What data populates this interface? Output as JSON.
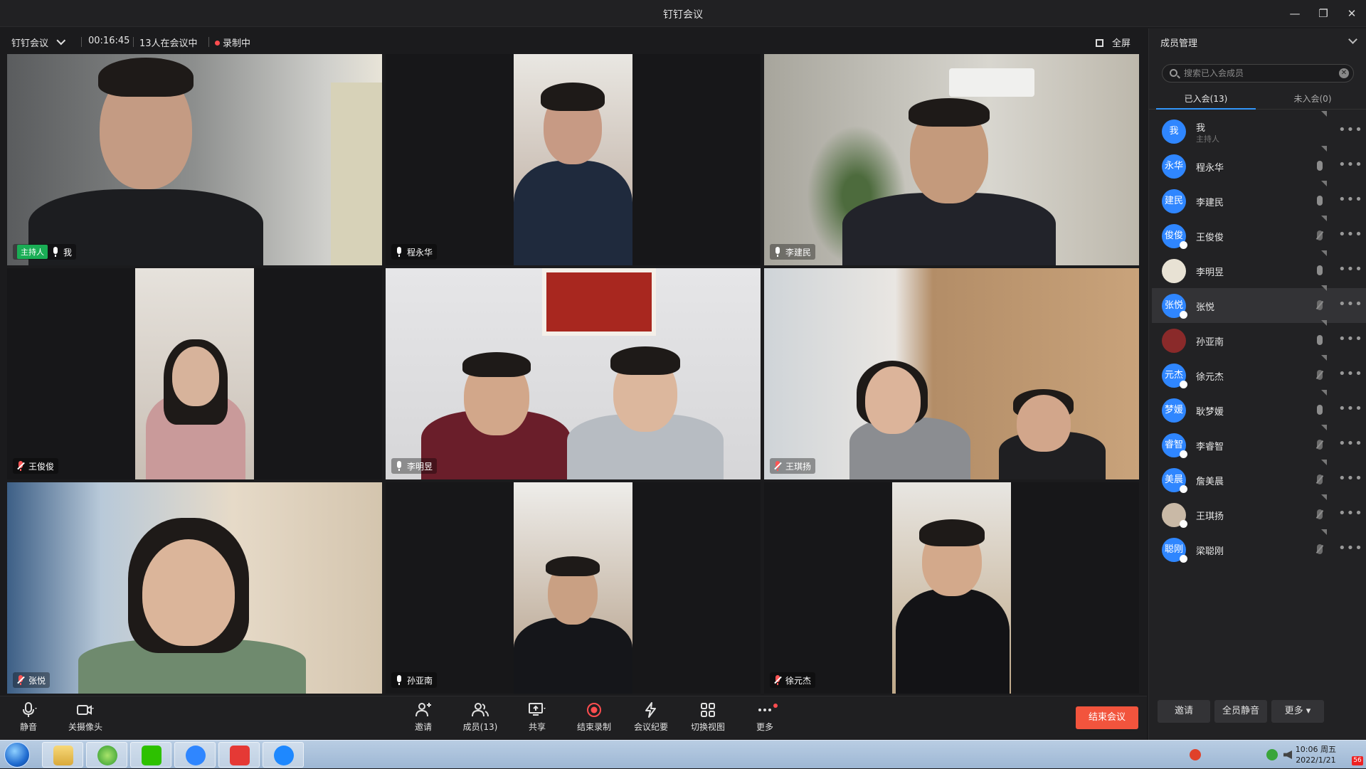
{
  "window": {
    "title": "钉钉会议",
    "minimize": "—",
    "restore": "❐",
    "close": "✕"
  },
  "infobar": {
    "app_label": "钉钉会议",
    "elapsed": "00:16:45",
    "count": "13人在会议中",
    "recording": "录制中",
    "fullscreen": "全屏"
  },
  "tiles": [
    {
      "name": "我",
      "host_badge": "主持人",
      "muted": false
    },
    {
      "name": "程永华",
      "muted": false
    },
    {
      "name": "李建民",
      "muted": false
    },
    {
      "name": "王俊俊",
      "muted": true
    },
    {
      "name": "李明昱",
      "muted": false
    },
    {
      "name": "王琪扬",
      "muted": true
    },
    {
      "name": "张悦",
      "muted": true
    },
    {
      "name": "孙亚南",
      "muted": false
    },
    {
      "name": "徐元杰",
      "muted": true
    }
  ],
  "toolbar": {
    "mute": "静音",
    "camera_off": "关摄像头",
    "invite": "邀请",
    "members": "成员(13)",
    "share": "共享",
    "stop_record": "结束录制",
    "minutes": "会议纪要",
    "switch_view": "切换视图",
    "more": "更多",
    "end_meeting": "结束会议"
  },
  "panel": {
    "title": "成员管理",
    "collapse_icon": "chevron-down",
    "search_placeholder": "搜索已入会成员",
    "tab_joined": "已入会(13)",
    "tab_not_joined": "未入会(0)",
    "more_dots": "•••",
    "members": [
      {
        "avatar": "我",
        "name": "我",
        "role": "主持人",
        "mic": "none",
        "color": "#2f86ff"
      },
      {
        "avatar": "永华",
        "name": "程永华",
        "mic": "on",
        "color": "#2f86ff"
      },
      {
        "avatar": "建民",
        "name": "李建民",
        "mic": "on",
        "color": "#2f86ff"
      },
      {
        "avatar": "俊俊",
        "name": "王俊俊",
        "mic": "off",
        "color": "#2f86ff"
      },
      {
        "avatar": "",
        "name": "李明昱",
        "mic": "on",
        "color": "#e8e2d4"
      },
      {
        "avatar": "张悦",
        "name": "张悦",
        "mic": "off",
        "color": "#2f86ff",
        "highlight": true
      },
      {
        "avatar": "",
        "name": "孙亚南",
        "mic": "on",
        "color": "#8a2a2a"
      },
      {
        "avatar": "元杰",
        "name": "徐元杰",
        "mic": "off",
        "color": "#2f86ff"
      },
      {
        "avatar": "梦媛",
        "name": "耿梦媛",
        "mic": "on",
        "color": "#2f86ff"
      },
      {
        "avatar": "睿智",
        "name": "李睿智",
        "mic": "off",
        "color": "#2f86ff"
      },
      {
        "avatar": "美晨",
        "name": "詹美晨",
        "mic": "off",
        "color": "#2f86ff"
      },
      {
        "avatar": "",
        "name": "王琪扬",
        "mic": "off",
        "color": "#c9b9a6"
      },
      {
        "avatar": "聪刚",
        "name": "梁聪刚",
        "mic": "off",
        "color": "#2f86ff"
      }
    ],
    "footer": {
      "invite": "邀请",
      "mute_all": "全员静音",
      "more": "更多 ▾"
    }
  },
  "taskbar": {
    "time": "10:06 周五",
    "date": "2022/1/21",
    "badge": "56"
  }
}
